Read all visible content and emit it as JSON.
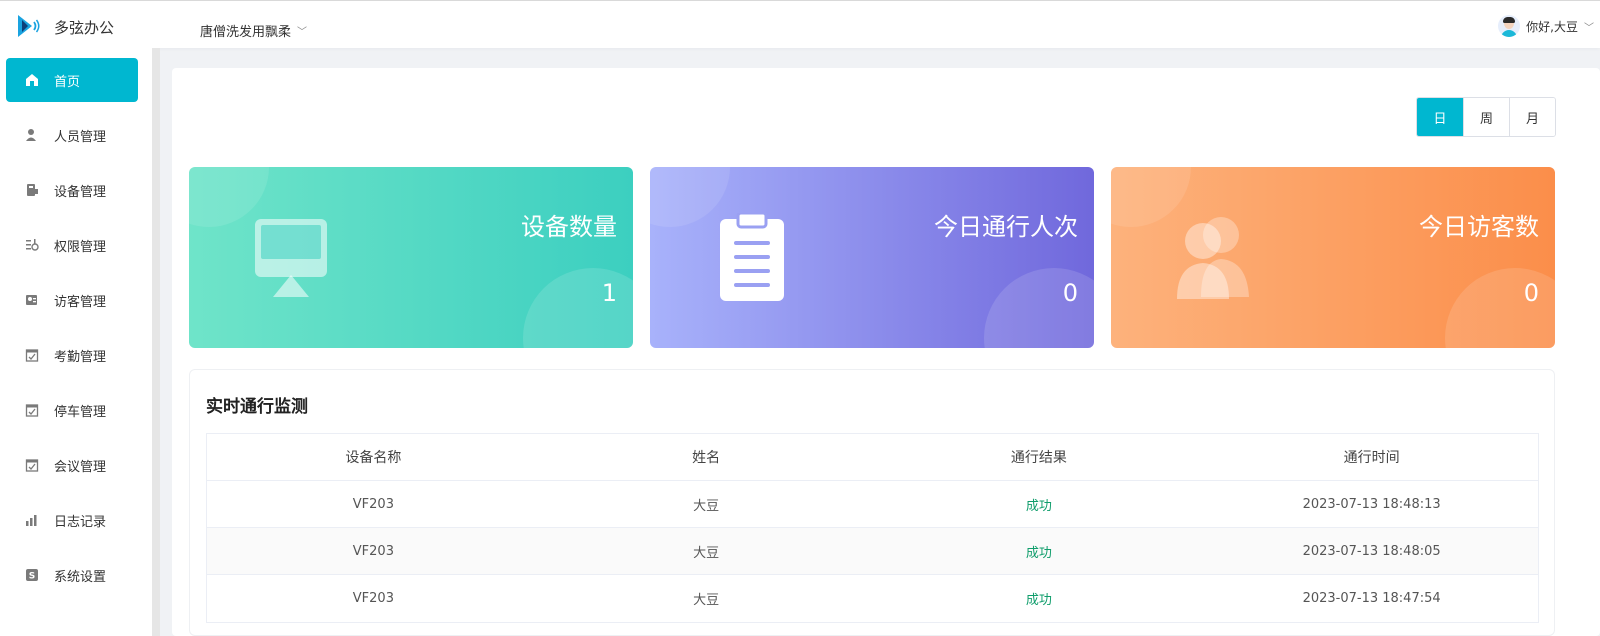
{
  "app": {
    "name": "多弦办公"
  },
  "header": {
    "org_name": "唐僧洗发用飘柔",
    "greeting": "你好,大豆"
  },
  "sidebar": {
    "items": [
      {
        "label": "首页",
        "icon": "home-icon",
        "active": true
      },
      {
        "label": "人员管理",
        "icon": "user-icon"
      },
      {
        "label": "设备管理",
        "icon": "device-icon"
      },
      {
        "label": "权限管理",
        "icon": "permission-icon"
      },
      {
        "label": "访客管理",
        "icon": "visitor-icon"
      },
      {
        "label": "考勤管理",
        "icon": "calendar-check-icon"
      },
      {
        "label": "停车管理",
        "icon": "calendar-check-icon"
      },
      {
        "label": "会议管理",
        "icon": "calendar-check-icon"
      },
      {
        "label": "日志记录",
        "icon": "bar-chart-icon"
      },
      {
        "label": "系统设置",
        "icon": "settings-s-icon"
      }
    ]
  },
  "range": {
    "day": "日",
    "week": "周",
    "month": "月",
    "selected": "日"
  },
  "stats": [
    {
      "title": "设备数量",
      "value": "1",
      "icon": "monitor-icon",
      "color": "#3ccfc0"
    },
    {
      "title": "今日通行人次",
      "value": "0",
      "icon": "clipboard-icon",
      "color": "#7068dc"
    },
    {
      "title": "今日访客数",
      "value": "0",
      "icon": "users-icon",
      "color": "#fb8e4a"
    }
  ],
  "monitor": {
    "title": "实时通行监测",
    "columns": [
      "设备名称",
      "姓名",
      "通行结果",
      "通行时间"
    ],
    "rows": [
      [
        "VF203",
        "大豆",
        "成功",
        "2023-07-13 18:48:13"
      ],
      [
        "VF203",
        "大豆",
        "成功",
        "2023-07-13 18:48:05"
      ],
      [
        "VF203",
        "大豆",
        "成功",
        "2023-07-13 18:47:54"
      ]
    ]
  },
  "colors": {
    "accent": "#00b7d0",
    "success": "#0f9d6b"
  }
}
